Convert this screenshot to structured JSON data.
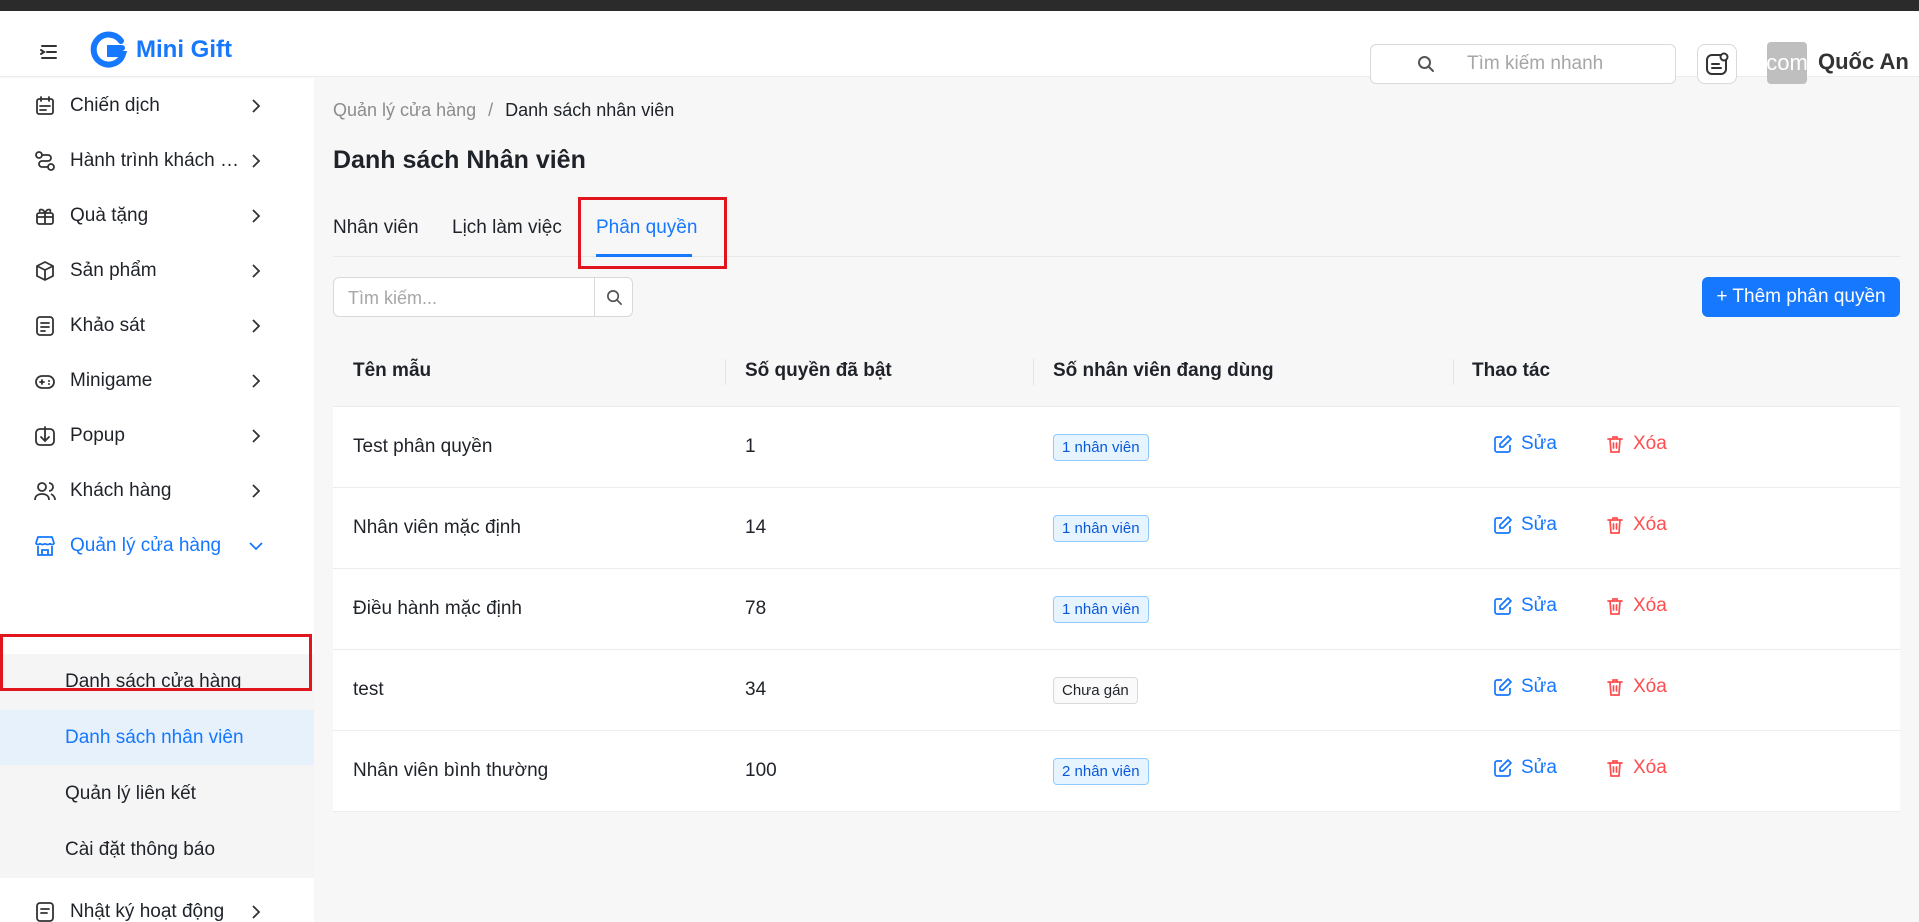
{
  "app": {
    "brand_name": "Mini Gift",
    "brand_color": "#1677ff"
  },
  "header": {
    "quick_search_placeholder": "Tìm kiếm nhanh",
    "avatar_text": "com",
    "user_name": "Quốc An"
  },
  "sidebar": {
    "items": [
      {
        "label": "Chiến dịch",
        "icon": "campaign-icon"
      },
      {
        "label": "Hành trình khách hàng",
        "icon": "journey-icon"
      },
      {
        "label": "Quà tặng",
        "icon": "gift-icon"
      },
      {
        "label": "Sản phẩm",
        "icon": "box-icon"
      },
      {
        "label": "Khảo sát",
        "icon": "survey-icon"
      },
      {
        "label": "Minigame",
        "icon": "game-icon"
      },
      {
        "label": "Popup",
        "icon": "popup-icon"
      },
      {
        "label": "Khách hàng",
        "icon": "users-icon"
      },
      {
        "label": "Quản lý cửa hàng",
        "icon": "store-icon"
      },
      {
        "label": "Nhật ký hoạt động",
        "icon": "log-icon"
      }
    ],
    "store_submenu": [
      {
        "label": "Danh sách cửa hàng"
      },
      {
        "label": "Danh sách nhân viên"
      },
      {
        "label": "Quản lý liên kết"
      },
      {
        "label": "Cài đặt thông báo"
      }
    ]
  },
  "breadcrumb": {
    "parent": "Quản lý cửa hàng",
    "separator": "/",
    "current": "Danh sách nhân viên"
  },
  "page_title": "Danh sách Nhân viên",
  "tabs": [
    {
      "label": "Nhân viên"
    },
    {
      "label": "Lịch làm việc"
    },
    {
      "label": "Phân quyền"
    }
  ],
  "active_tab": "Phân quyền",
  "search": {
    "placeholder": "Tìm kiếm..."
  },
  "add_button_label": "+ Thêm phân quyền",
  "table": {
    "columns": [
      "Tên mẫu",
      "Số quyền đã bật",
      "Số nhân viên đang dùng",
      "Thao tác"
    ],
    "rows": [
      {
        "name": "Test phân quyền",
        "count": "1",
        "usage": "1 nhân viên",
        "usage_style": "blue"
      },
      {
        "name": "Nhân viên mặc định",
        "count": "14",
        "usage": "1 nhân viên",
        "usage_style": "blue"
      },
      {
        "name": "Điều hành mặc định",
        "count": "78",
        "usage": "1 nhân viên",
        "usage_style": "blue"
      },
      {
        "name": "test",
        "count": "34",
        "usage": "Chưa gán",
        "usage_style": "gray"
      },
      {
        "name": "Nhân viên bình thường",
        "count": "100",
        "usage": "2 nhân viên",
        "usage_style": "blue"
      }
    ],
    "edit_label": "Sửa",
    "delete_label": "Xóa"
  },
  "colors": {
    "primary": "#1677ff",
    "danger": "#ff4d4f",
    "highlight": "#e0151e"
  }
}
